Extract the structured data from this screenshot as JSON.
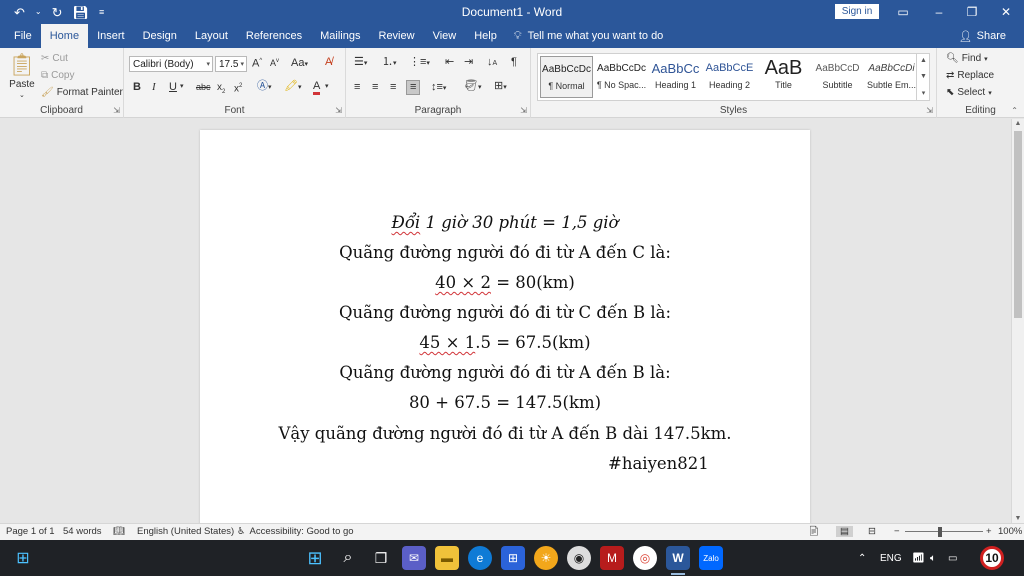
{
  "window": {
    "title": "Document1 - Word",
    "sign_in": "Sign in",
    "minimize": "–",
    "restore": "❐",
    "close": "✕"
  },
  "tabs": [
    "File",
    "Home",
    "Insert",
    "Design",
    "Layout",
    "References",
    "Mailings",
    "Review",
    "View",
    "Help"
  ],
  "tell_me": "Tell me what you want to do",
  "share": "Share",
  "ribbon": {
    "clipboard": {
      "paste": "Paste",
      "cut": "Cut",
      "copy": "Copy",
      "format_painter": "Format Painter",
      "label": "Clipboard"
    },
    "font": {
      "name": "Calibri (Body)",
      "size": "17.5",
      "label": "Font"
    },
    "paragraph": {
      "label": "Paragraph"
    },
    "styles": {
      "label": "Styles",
      "items": [
        {
          "sample": "AaBbCcDc",
          "name": "¶ Normal"
        },
        {
          "sample": "AaBbCcDc",
          "name": "¶ No Spac..."
        },
        {
          "sample": "AaBbCc",
          "name": "Heading 1"
        },
        {
          "sample": "AaBbCcE",
          "name": "Heading 2"
        },
        {
          "sample": "AaB",
          "name": "Title"
        },
        {
          "sample": "AaBbCcD",
          "name": "Subtitle"
        },
        {
          "sample": "AaBbCcDi",
          "name": "Subtle Em..."
        }
      ]
    },
    "editing": {
      "find": "Find",
      "replace": "Replace",
      "select": "Select",
      "label": "Editing"
    }
  },
  "document": {
    "lines": [
      {
        "a": "Đổi",
        "b": " 1 giờ 30 phút = 1,5 giờ"
      },
      {
        "a": "Quãng đường người đó đi từ A đến C là:"
      },
      {
        "a": "40  × 2",
        "b": " = 80(km)"
      },
      {
        "a": "Quãng đường người đó đi từ C đến B là:"
      },
      {
        "a": "45  × 1",
        "b": ".5 = 67.5(km)"
      },
      {
        "a": "Quãng đường người đó đi từ A đến B là:"
      },
      {
        "a": "80 + 67.5 = 147.5(km)"
      },
      {
        "a": "Vậy quãng đường người đó đi từ A đến B dài 147.5km."
      },
      {
        "a": "#haiyen821"
      }
    ]
  },
  "status": {
    "page": "Page 1 of 1",
    "words": "54 words",
    "language": "English (United States)",
    "accessibility": "Accessibility: Good to go",
    "zoom": "100%"
  },
  "taskbar": {
    "lang": "ENG",
    "badge": "10",
    "zalo": "Zalo"
  },
  "colors": {
    "word_blue": "#2b579a",
    "taskbar": "#1f2226",
    "spell_red": "#d13438"
  }
}
